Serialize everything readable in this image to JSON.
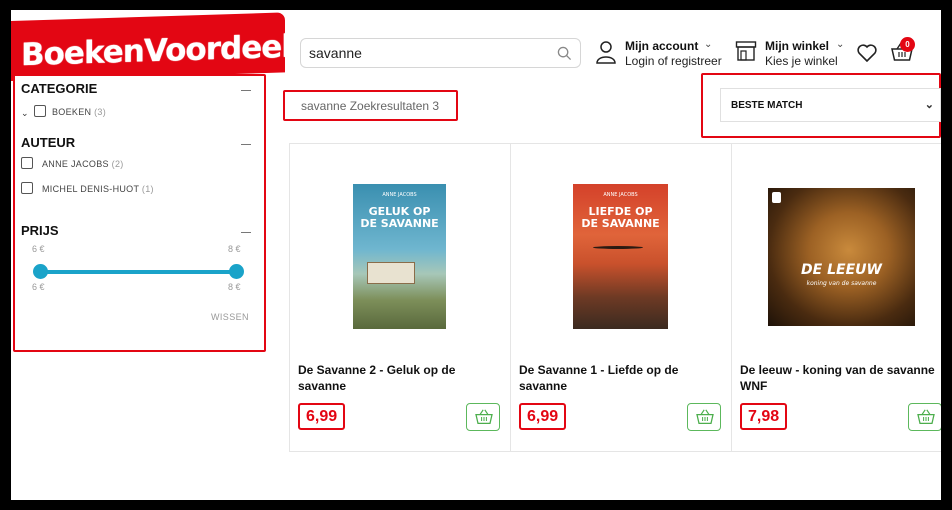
{
  "brand": {
    "logo_text": "BoekenVoordeel",
    "accent": "#e30613",
    "slider_color": "#1aa3c9"
  },
  "header": {
    "search_value": "savanne",
    "search_icon": "search-icon",
    "account_title": "Mijn account",
    "account_sub": "Login of registreer",
    "store_title": "Mijn winkel",
    "store_sub": "Kies je winkel",
    "cart_count": "0"
  },
  "filters": {
    "category": {
      "title": "CATEGORIE",
      "items": [
        {
          "label": "BOEKEN",
          "count": "(3)"
        }
      ]
    },
    "author": {
      "title": "AUTEUR",
      "items": [
        {
          "label": "ANNE JACOBS",
          "count": "(2)"
        },
        {
          "label": "MICHEL DENIS-HUOT",
          "count": "(1)"
        }
      ]
    },
    "price": {
      "title": "PRIJS",
      "min_top": "6 €",
      "max_top": "8 €",
      "min_bottom": "6 €",
      "max_bottom": "8 €",
      "clear": "WISSEN"
    }
  },
  "results": {
    "label": "savanne Zoekresultaten 3"
  },
  "sort": {
    "selected": "BESTE MATCH"
  },
  "products": [
    {
      "title": "De Savanne 2 - Geluk op de savanne",
      "price": "6,99",
      "cover_author": "ANNE JACOBS",
      "cover_title": "GELUK OP DE SAVANNE"
    },
    {
      "title": "De Savanne 1 - Liefde op de savanne",
      "price": "6,99",
      "cover_author": "ANNE JACOBS",
      "cover_title": "LIEFDE OP DE SAVANNE"
    },
    {
      "title": "De leeuw - koning van de savanne WNF",
      "price": "7,98",
      "cover_title": "DE LEEUW",
      "cover_sub": "koning van de savanne"
    }
  ]
}
